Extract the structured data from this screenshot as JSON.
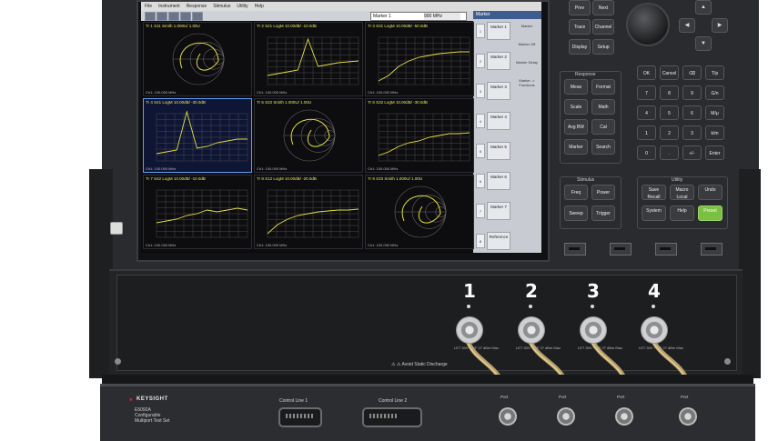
{
  "menu": [
    "File",
    "Instrument",
    "Response",
    "Stimulus",
    "Utility",
    "Help"
  ],
  "marker_bar": {
    "label": "Marker 1",
    "value": "900 MHz"
  },
  "softkey_panel": {
    "title": "Marker",
    "keys": [
      "Marker 1",
      "Marker 2",
      "Marker 3",
      "Marker 4",
      "Marker 5",
      "Marker 6",
      "Marker 7",
      "Reference"
    ],
    "nums": [
      "1",
      "2",
      "3",
      "4",
      "5",
      "6",
      "7",
      "8"
    ],
    "infos": [
      "Marker",
      "Marker\nOff",
      "Marker\nDelay",
      "Marker ->\nFunctions"
    ]
  },
  "traces": [
    {
      "head": "Tr 1  S11 Smith 1.000U/ 1.00U",
      "foot": "Ch1: 100.000 MHz"
    },
    {
      "head": "Tr 2  S21 LogM 10.00dB/ -10.0dB",
      "foot": "Ch1: 100.000 MHz"
    },
    {
      "head": "Tr 3  S31 LogM 10.00dB/ -50.0dB",
      "foot": "Ch1: 100.000 MHz"
    },
    {
      "head": "Tr 4  S41 LogM 10.00dB/ -30.0dB",
      "foot": "Ch1: 100.000 MHz"
    },
    {
      "head": "Tr 5  S22 Smith 1.000U/ 1.00U",
      "foot": "Ch1: 100.000 MHz"
    },
    {
      "head": "Tr 6  S32 LogM 10.00dB/ -30.0dB",
      "foot": "Ch1: 100.000 MHz"
    },
    {
      "head": "Tr 7  S42 LogM 10.00dB/ -10.0dB",
      "foot": "Ch1: 100.000 MHz"
    },
    {
      "head": "Tr 8  S12 LogM 10.00dB/ -20.0dB",
      "foot": "Ch1: 100.000 MHz"
    },
    {
      "head": "Tr 9  S33 Smith 1.000U/ 1.00U",
      "foot": "Ch1: 100.000 MHz"
    }
  ],
  "front_keys": {
    "top": [
      "Prev",
      "Next",
      "Trace",
      "Channel",
      "Display",
      "Setup"
    ],
    "response_label": "Response",
    "response": [
      "Meas",
      "Format",
      "Scale",
      "Math",
      "Avg BW",
      "Cal",
      "Marker",
      "Search"
    ],
    "stimulus_label": "Stimulus",
    "stimulus": [
      "Freq",
      "Power",
      "Sweep",
      "Trigger"
    ],
    "utility_label": "Utility",
    "utility": [
      "Save Recall",
      "Macro Local",
      "Undo",
      "System",
      "Help",
      "Preset"
    ],
    "keypad": [
      "OK",
      "Cancel",
      "⌫",
      "T/p",
      "7",
      "8",
      "9",
      "G/n",
      "4",
      "5",
      "6",
      "M/μ",
      "1",
      "2",
      "3",
      "k/m",
      "0",
      ".",
      "+/-",
      "Enter"
    ]
  },
  "ports": [
    "1",
    "2",
    "3",
    "4"
  ],
  "port_warning": "LET 30V + RF 27 dBm Max",
  "static_warning": "⚠ ⚠ Avoid Static Discharge",
  "testset": {
    "brand": "KEYSIGHT",
    "model_line1": "E5092A",
    "model_line2": "Configurable",
    "model_line3": "Multiport Test Set",
    "control1": "Control Line 1",
    "control2": "Control Line 2",
    "port_labels": [
      "Port",
      "Port",
      "Port",
      "Port"
    ]
  }
}
